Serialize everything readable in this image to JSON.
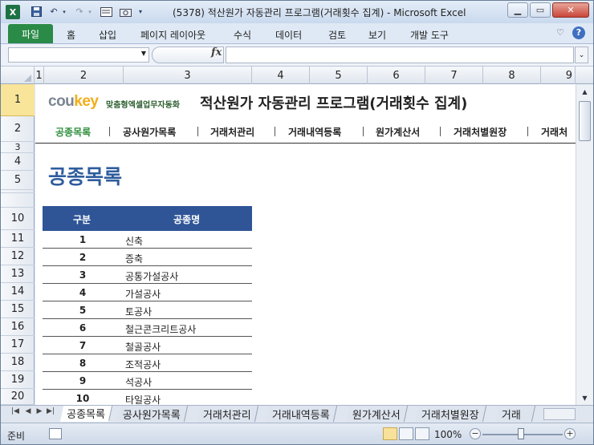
{
  "window": {
    "title": "(5378) 적산원가 자동관리 프로그램(거래횟수 집계)  -  Microsoft Excel",
    "app_icon": "X"
  },
  "ribbon": {
    "file_tab": "파일",
    "tabs": [
      "홈",
      "삽입",
      "페이지 레이아웃",
      "수식",
      "데이터",
      "검토",
      "보기",
      "개발 도구"
    ]
  },
  "formula_bar": {
    "name_box": "",
    "fx_label": "fx",
    "formula": ""
  },
  "columns": [
    "1",
    "2",
    "3",
    "4",
    "5",
    "6",
    "7",
    "8",
    "9"
  ],
  "rows": [
    "1",
    "2",
    "3",
    "4",
    "5",
    "",
    "",
    "10",
    "11",
    "12",
    "13",
    "14",
    "15",
    "16",
    "17",
    "18",
    "19",
    "20"
  ],
  "header": {
    "logo_main": "cou",
    "logo_accent": "key",
    "logo_tagline": "맞춤형엑셀업무자동화",
    "title": "적산원가 자동관리 프로그램(거래횟수 집계)"
  },
  "nav": [
    "공종목록",
    "공사원가목록",
    "거래처관리",
    "거래내역등록",
    "원가계산서",
    "거래처별원장",
    "거래처"
  ],
  "section_title": "공종목록",
  "table": {
    "headers": [
      "구분",
      "공종명"
    ],
    "rows": [
      {
        "no": "1",
        "name": "신축"
      },
      {
        "no": "2",
        "name": "증축"
      },
      {
        "no": "3",
        "name": "공통가설공사"
      },
      {
        "no": "4",
        "name": "가설공사"
      },
      {
        "no": "5",
        "name": "토공사"
      },
      {
        "no": "6",
        "name": "철근콘크리트공사"
      },
      {
        "no": "7",
        "name": "철골공사"
      },
      {
        "no": "8",
        "name": "조적공사"
      },
      {
        "no": "9",
        "name": "석공사"
      },
      {
        "no": "10",
        "name": "타일공사"
      }
    ]
  },
  "sheet_tabs": [
    "공종목록",
    "공사원가목록",
    "거래처관리",
    "거래내역등록",
    "원가계산서",
    "거래처별원장",
    "거래"
  ],
  "status": {
    "ready": "준비",
    "zoom": "100%"
  },
  "colors": {
    "table_header": "#2f5597",
    "section_title": "#2f5d9e",
    "active_nav": "#2f8f3d",
    "file_tab": "#2a8a47"
  }
}
